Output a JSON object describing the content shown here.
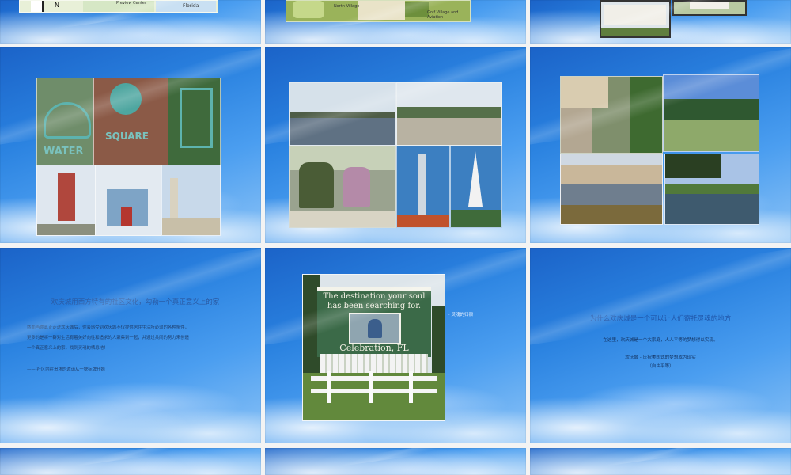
{
  "row1": {
    "map1": {
      "label_a": "N",
      "label_b": "Preview Center",
      "label_c": "Florida"
    },
    "map2": {
      "label_a": "North Village",
      "label_b": "Golf Village and Aviation"
    }
  },
  "slide4_signs": [
    "WATER",
    "SQUARE"
  ],
  "slide7": {
    "title": "欢庆城用西方特有的社区文化，勾勒一个真正意义上的家",
    "body1": "然而当你真正走进欢庆城后，你会感受到欢庆城不仅提供居住生活所必须的各种条件，",
    "body2": "更多的是将一群对生活有着美好向往和追求的人聚集到一起，并通过共同的努力来创造",
    "body3": "一个真正意义上的家，找到灵魂的栖息地！",
    "quote": "—— 社区内在追求的邀请从一块标牌开始"
  },
  "slide8": {
    "billboard_line1": "The destination your soul",
    "billboard_line2": "has been searching for.",
    "billboard_brand": "Celebration, FL",
    "caption": "· 灵魂的归宿"
  },
  "slide9": {
    "title": "为什么欢庆城是一个可以让人们寄托灵魂的地方",
    "line1": "在这里，欢庆城是一个大家庭，人人平等的梦想得以实现。",
    "line2": "欢庆城 - 庆祝美国式的梦想成为现实",
    "line3": "（自由平等）"
  },
  "colors": {
    "slide_blue": "#2a82e0",
    "title_blue": "#1f55a8"
  }
}
